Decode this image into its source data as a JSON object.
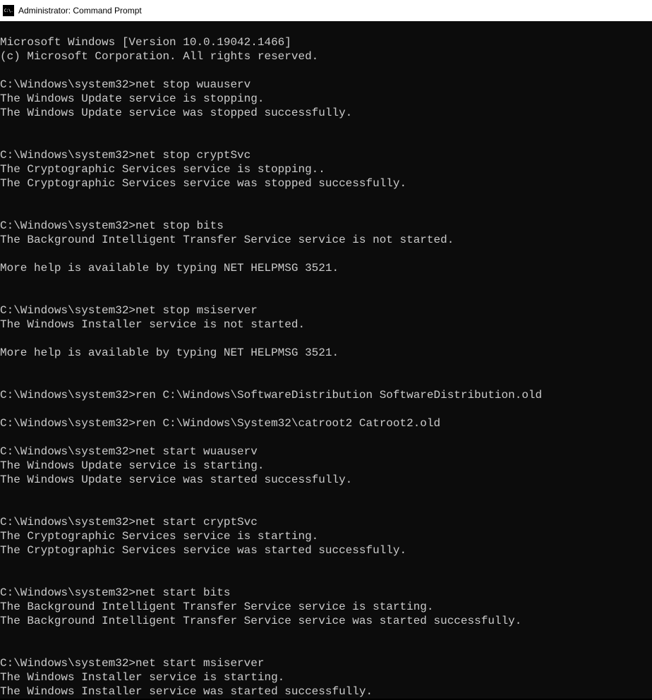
{
  "titlebar": {
    "icon_text": "C:\\.",
    "title": "Administrator: Command Prompt"
  },
  "terminal": {
    "lines": [
      "Microsoft Windows [Version 10.0.19042.1466]",
      "(c) Microsoft Corporation. All rights reserved.",
      "",
      "C:\\Windows\\system32>net stop wuauserv",
      "The Windows Update service is stopping.",
      "The Windows Update service was stopped successfully.",
      "",
      "",
      "C:\\Windows\\system32>net stop cryptSvc",
      "The Cryptographic Services service is stopping..",
      "The Cryptographic Services service was stopped successfully.",
      "",
      "",
      "C:\\Windows\\system32>net stop bits",
      "The Background Intelligent Transfer Service service is not started.",
      "",
      "More help is available by typing NET HELPMSG 3521.",
      "",
      "",
      "C:\\Windows\\system32>net stop msiserver",
      "The Windows Installer service is not started.",
      "",
      "More help is available by typing NET HELPMSG 3521.",
      "",
      "",
      "C:\\Windows\\system32>ren C:\\Windows\\SoftwareDistribution SoftwareDistribution.old",
      "",
      "C:\\Windows\\system32>ren C:\\Windows\\System32\\catroot2 Catroot2.old",
      "",
      "C:\\Windows\\system32>net start wuauserv",
      "The Windows Update service is starting.",
      "The Windows Update service was started successfully.",
      "",
      "",
      "C:\\Windows\\system32>net start cryptSvc",
      "The Cryptographic Services service is starting.",
      "The Cryptographic Services service was started successfully.",
      "",
      "",
      "C:\\Windows\\system32>net start bits",
      "The Background Intelligent Transfer Service service is starting.",
      "The Background Intelligent Transfer Service service was started successfully.",
      "",
      "",
      "C:\\Windows\\system32>net start msiserver",
      "The Windows Installer service is starting.",
      "The Windows Installer service was started successfully."
    ]
  }
}
